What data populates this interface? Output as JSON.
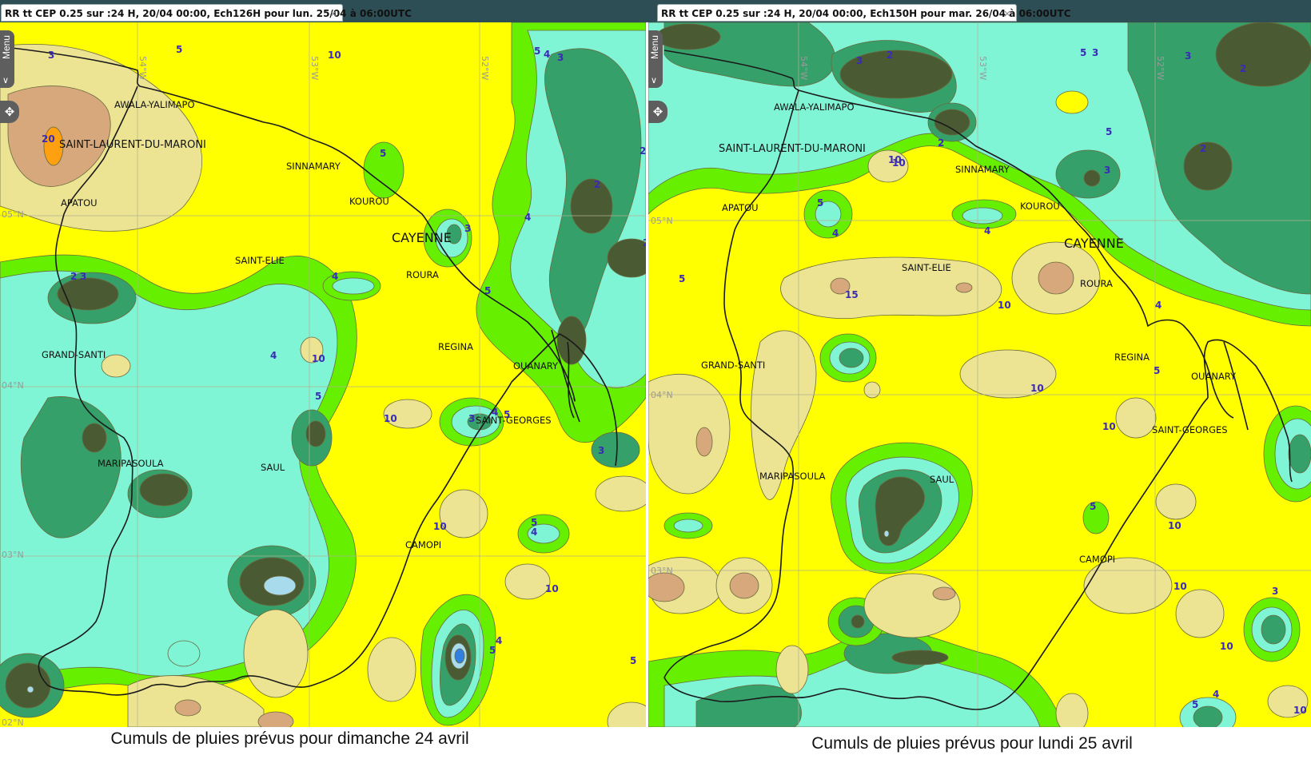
{
  "colors": {
    "bg_yellow": "#ffff00",
    "rr_3": "#66f000",
    "rr_2": "#7ff5d5",
    "rr_1": "#35a06a",
    "rr_0": "#4a5a32",
    "rr_10": "#ece492",
    "rr_15": "#d6a87c",
    "rr_20": "#ffa010",
    "rr_4": "#a8dcec",
    "rr_5": "#2f80e0",
    "border": "#1a1a1a",
    "topbar": "#2d4e55"
  },
  "left": {
    "tab_title": "RR tt CEP 0.25 sur :24 H, 20/04 00:00, Ech126H pour lun. 25/04 à 06:00UTC",
    "close_icon": "×",
    "menu_label": "Menu",
    "caption": "Cumuls de pluies prévus pour dimanche 24 avril",
    "axes": [
      "54°W",
      "53°W",
      "52°W",
      "05°N",
      "04°N",
      "03°N",
      "02°N"
    ],
    "towns": [
      "AWALA-YALIMAPO",
      "SAINT-LAURENT-DU-MARONI",
      "SINNAMARY",
      "KOUROU",
      "APATOU",
      "CAYENNE",
      "SAINT-ELIE",
      "ROURA",
      "REGINA",
      "OUANARY",
      "GRAND-SANTI",
      "SAINT-GEORGES",
      "MARIPASOULA",
      "SAUL",
      "CAMOPI"
    ],
    "contour_labels": [
      "3",
      "5",
      "10",
      "5",
      "4",
      "3",
      "20",
      "5",
      "2",
      "2",
      "3",
      "4",
      "2",
      "4",
      "5",
      "3",
      "2",
      "10",
      "4",
      "5",
      "10",
      "3",
      "4",
      "5",
      "3",
      "10",
      "5",
      "4",
      "10",
      "5",
      "4",
      "5"
    ]
  },
  "right": {
    "tab_title": "RR tt CEP 0.25 sur :24 H, 20/04 00:00, Ech150H pour mar. 26/04 à 06:00UTC",
    "close_icon": "×",
    "menu_label": "Menu",
    "caption": "Cumuls de pluies prévus pour lundi 25 avril",
    "axes": [
      "54°W",
      "53°W",
      "52°W",
      "05°N",
      "04°N",
      "03°N"
    ],
    "towns": [
      "AWALA-YALIMAPO",
      "SAINT-LAURENT-DU-MARONI",
      "SINNAMARY",
      "KOUROU",
      "APATOU",
      "CAYENNE",
      "SAINT-ELIE",
      "ROURA",
      "REGINA",
      "OUANARY",
      "GRAND-SANTI",
      "SAINT-GEORGES",
      "MARIPASOULA",
      "SAUL",
      "CAMOPI"
    ],
    "contour_labels": [
      "3",
      "2",
      "3",
      "5",
      "3",
      "2",
      "2",
      "5",
      "3",
      "2",
      "10",
      "4",
      "5",
      "4",
      "5",
      "15",
      "10",
      "4",
      "10",
      "5",
      "10",
      "10",
      "5",
      "10",
      "10",
      "3",
      "10",
      "4",
      "5",
      "10"
    ]
  }
}
